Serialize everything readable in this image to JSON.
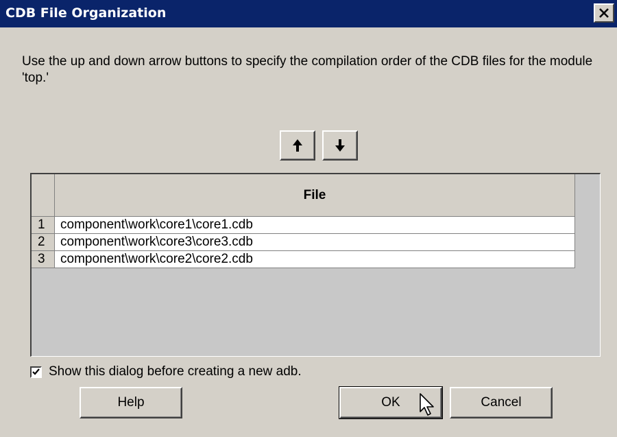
{
  "window": {
    "title": "CDB File Organization",
    "close_symbol": "✕"
  },
  "instruction": "Use the up and down arrow buttons to specify the compilation order of the CDB files for the module 'top.'",
  "order_buttons": {
    "up_icon": "arrow-up-icon",
    "down_icon": "arrow-down-icon"
  },
  "table": {
    "column_header": "File",
    "rows": [
      {
        "num": "1",
        "file": "component\\work\\core1\\core1.cdb"
      },
      {
        "num": "2",
        "file": "component\\work\\core3\\core3.cdb"
      },
      {
        "num": "3",
        "file": "component\\work\\core2\\core2.cdb"
      }
    ]
  },
  "show_dialog_checkbox": {
    "label": "Show this dialog before creating a new adb.",
    "checked": true
  },
  "buttons": {
    "help": "Help",
    "ok": "OK",
    "cancel": "Cancel"
  }
}
